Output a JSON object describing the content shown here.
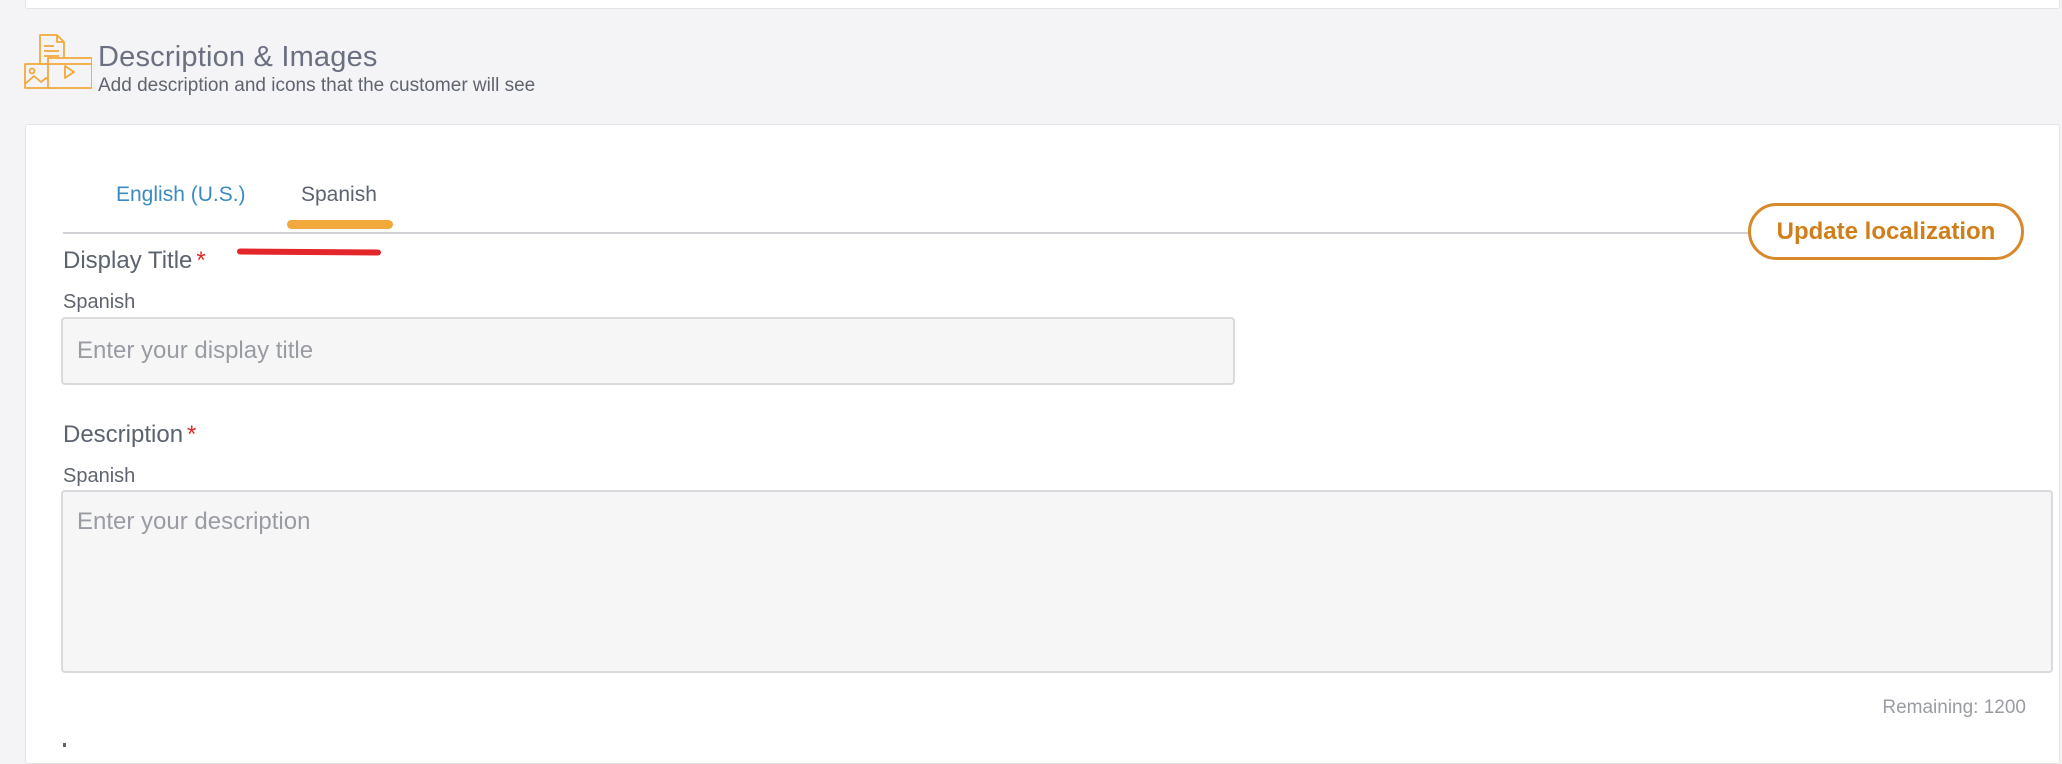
{
  "section": {
    "title": "Description & Images",
    "subtitle": "Add description and icons that the customer will see",
    "icon": "description-images-icon"
  },
  "tabs": [
    {
      "label": "English (U.S.)",
      "active": false
    },
    {
      "label": "Spanish",
      "active": true
    }
  ],
  "actions": {
    "update_localization_label": "Update localization"
  },
  "fields": {
    "display_title": {
      "label": "Display Title",
      "required_mark": "*",
      "language": "Spanish",
      "value": "",
      "placeholder": "Enter your display title"
    },
    "description": {
      "label": "Description",
      "required_mark": "*",
      "language": "Spanish",
      "value": "",
      "placeholder": "Enter your description",
      "remaining_text": "Remaining: 1200"
    }
  },
  "colors": {
    "accent_orange": "#d8892b",
    "tab_indicator": "#f2a93b",
    "link_blue": "#3b8bc2",
    "required_red": "#e3262a",
    "annotation_red": "#e3262a"
  }
}
